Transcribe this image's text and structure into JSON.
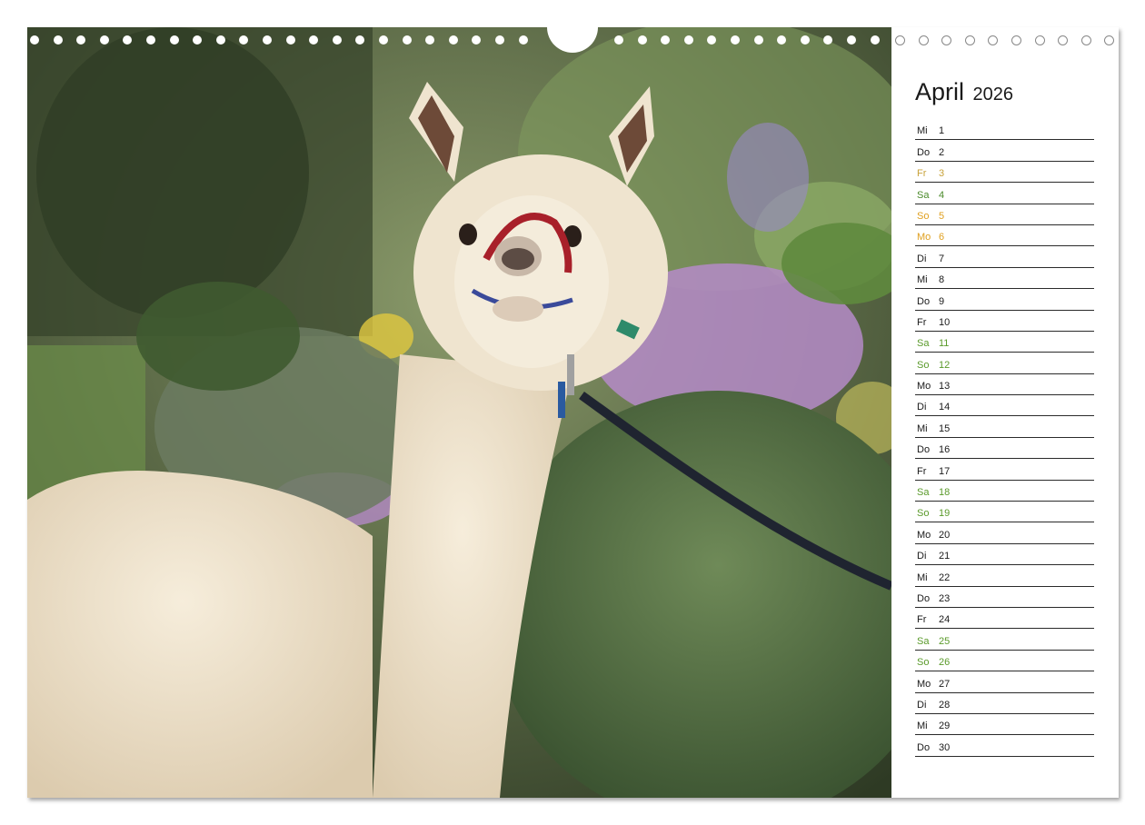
{
  "calendar": {
    "month": "April",
    "year": "2026",
    "days": [
      {
        "wd": "Mi",
        "day": "1",
        "style": ""
      },
      {
        "wd": "Do",
        "day": "2",
        "style": ""
      },
      {
        "wd": "Fr",
        "day": "3",
        "style": "fr-hl"
      },
      {
        "wd": "Sa",
        "day": "4",
        "style": "sa-hl"
      },
      {
        "wd": "So",
        "day": "5",
        "style": "so-hl"
      },
      {
        "wd": "Mo",
        "day": "6",
        "style": "mo-hl"
      },
      {
        "wd": "Di",
        "day": "7",
        "style": ""
      },
      {
        "wd": "Mi",
        "day": "8",
        "style": ""
      },
      {
        "wd": "Do",
        "day": "9",
        "style": ""
      },
      {
        "wd": "Fr",
        "day": "10",
        "style": ""
      },
      {
        "wd": "Sa",
        "day": "11",
        "style": "green"
      },
      {
        "wd": "So",
        "day": "12",
        "style": "green"
      },
      {
        "wd": "Mo",
        "day": "13",
        "style": ""
      },
      {
        "wd": "Di",
        "day": "14",
        "style": ""
      },
      {
        "wd": "Mi",
        "day": "15",
        "style": ""
      },
      {
        "wd": "Do",
        "day": "16",
        "style": ""
      },
      {
        "wd": "Fr",
        "day": "17",
        "style": ""
      },
      {
        "wd": "Sa",
        "day": "18",
        "style": "green"
      },
      {
        "wd": "So",
        "day": "19",
        "style": "green"
      },
      {
        "wd": "Mo",
        "day": "20",
        "style": ""
      },
      {
        "wd": "Di",
        "day": "21",
        "style": ""
      },
      {
        "wd": "Mi",
        "day": "22",
        "style": ""
      },
      {
        "wd": "Do",
        "day": "23",
        "style": ""
      },
      {
        "wd": "Fr",
        "day": "24",
        "style": ""
      },
      {
        "wd": "Sa",
        "day": "25",
        "style": "green"
      },
      {
        "wd": "So",
        "day": "26",
        "style": "green"
      },
      {
        "wd": "Mo",
        "day": "27",
        "style": ""
      },
      {
        "wd": "Di",
        "day": "28",
        "style": ""
      },
      {
        "wd": "Mi",
        "day": "29",
        "style": ""
      },
      {
        "wd": "Do",
        "day": "30",
        "style": ""
      }
    ]
  },
  "photo": {
    "subject": "alpaca-photo",
    "colors": {
      "fleece": "#efe4cf",
      "foliage": "#5e7a44",
      "flowers": "#b07cc0",
      "halter": "#a8202a",
      "leash": "#1f2430"
    }
  }
}
